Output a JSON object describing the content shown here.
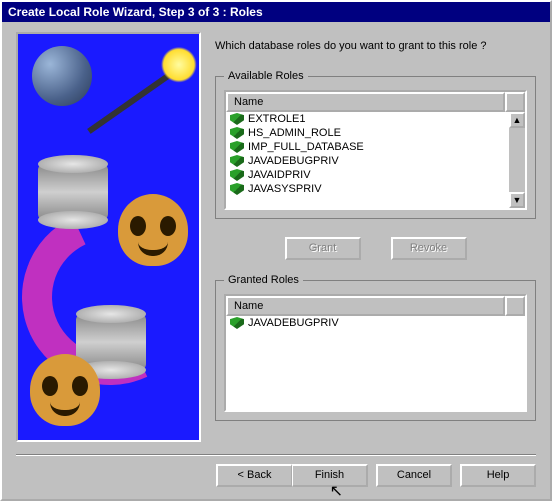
{
  "title": "Create Local Role Wizard, Step 3 of 3 : Roles",
  "prompt": "Which database roles do you want to grant to this role ?",
  "available": {
    "legend": "Available Roles",
    "column": "Name",
    "items": [
      "EXTROLE1",
      "HS_ADMIN_ROLE",
      "IMP_FULL_DATABASE",
      "JAVADEBUGPRIV",
      "JAVAIDPRIV",
      "JAVASYSPRIV"
    ]
  },
  "granted": {
    "legend": "Granted Roles",
    "column": "Name",
    "items": [
      "JAVADEBUGPRIV"
    ]
  },
  "buttons": {
    "grant": "Grant",
    "revoke": "Revoke",
    "back": "< Back",
    "finish": "Finish",
    "cancel": "Cancel",
    "help": "Help"
  }
}
